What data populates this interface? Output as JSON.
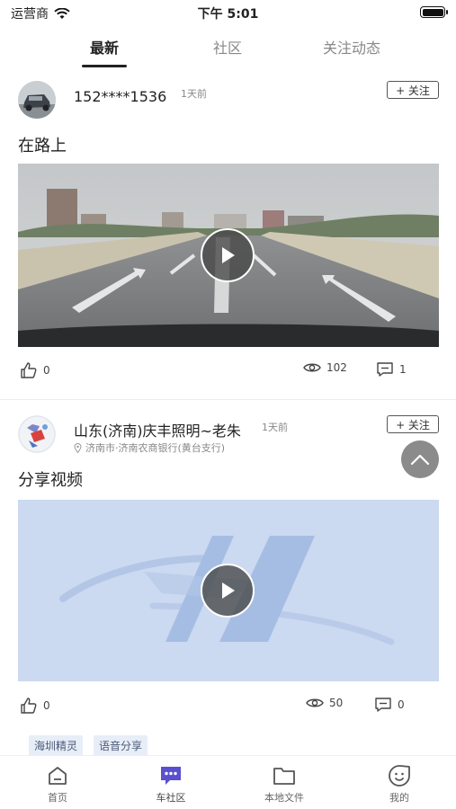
{
  "status_bar": {
    "carrier": "运营商",
    "time": "下午 5:01"
  },
  "tabs": [
    {
      "label": "最新",
      "active": true
    },
    {
      "label": "社区",
      "active": false
    },
    {
      "label": "关注动态",
      "active": false
    }
  ],
  "posts": [
    {
      "username": "152****1536",
      "time_ago": "1天前",
      "follow_label": "+ 关注",
      "title": "在路上",
      "likes": "0",
      "views": "102",
      "comments": "1"
    },
    {
      "username": "山东(济南)庆丰照明~老朱",
      "time_ago": "1天前",
      "follow_label": "+ 关注",
      "location": "济南市·济南农商银行(黄台支行)",
      "title": "分享视频",
      "likes": "0",
      "views": "50",
      "comments": "0",
      "tags": [
        "海圳精灵",
        "语音分享"
      ]
    }
  ],
  "bottom_nav": [
    {
      "label": "首页",
      "icon": "home-icon"
    },
    {
      "label": "车社区",
      "icon": "chat-icon",
      "active": true
    },
    {
      "label": "本地文件",
      "icon": "folder-icon"
    },
    {
      "label": "我的",
      "icon": "smile-icon"
    }
  ],
  "colors": {
    "accent": "#5a4fcf",
    "tag_bg": "#e8eef7",
    "follow_border": "#555555"
  }
}
